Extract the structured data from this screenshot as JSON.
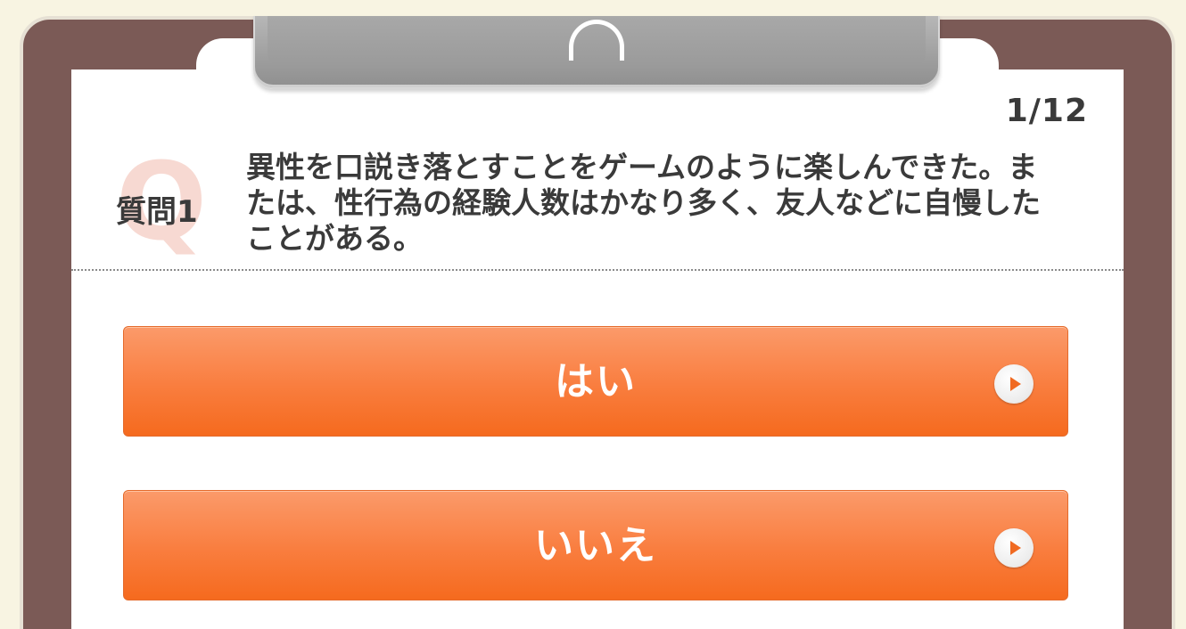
{
  "progress": {
    "counter": "1/12"
  },
  "question": {
    "watermark": "Q",
    "label": "質問1",
    "text": "異性を口説き落とすことをゲームのように楽しんできた。または、性行為の経験人数はかなり多く、友人などに自慢したことがある。"
  },
  "answers": [
    {
      "label": "はい",
      "icon": "play-icon"
    },
    {
      "label": "いいえ",
      "icon": "play-icon"
    }
  ],
  "colors": {
    "background": "#f8f4e2",
    "board": "#7b5a56",
    "button": "#f97d3e",
    "text": "#3a3a3a"
  }
}
